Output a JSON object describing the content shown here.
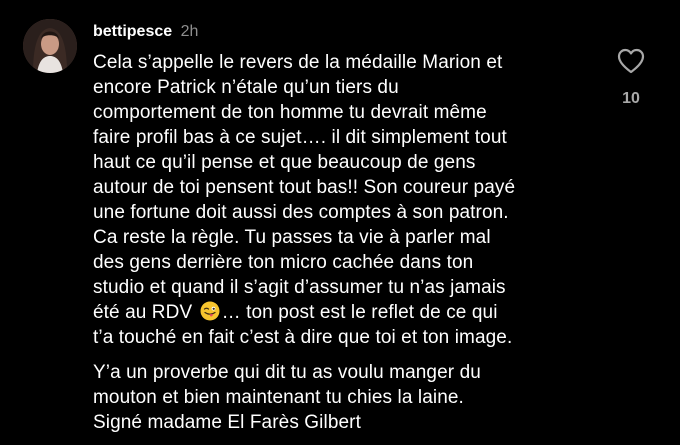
{
  "comment": {
    "username": "bettipesce",
    "timestamp": "2h",
    "paragraphs": [
      [
        "Cela  s’appelle le revers de la médaille Marion et",
        "encore Patrick n’étale qu’un tiers du",
        "comportement de ton homme tu devrait même",
        "faire profil bas à ce sujet…. il dit simplement tout",
        "haut ce qu’il pense et que beaucoup de gens",
        "autour de toi pensent tout bas!! Son coureur payé",
        "une fortune doit aussi des  comptes à son patron.",
        "Ca reste la règle. Tu passes ta vie à parler mal",
        "des gens derrière ton micro cachée dans ton",
        "studio et quand il s’agit d’assumer tu n’as jamais"
      ],
      [
        "Y’a un proverbe qui dit tu as voulu manger du",
        "mouton et bien maintenant tu chies la laine.",
        "Signé madame El Farès Gilbert"
      ]
    ],
    "emoji_line_before": "été au RDV",
    "emoji_name": "winking-face-with-tongue",
    "emoji_line_after": "… ton post est le reflet de ce qui",
    "last_line_para1": "t’a touché en fait c’est à dire que toi et ton image.",
    "like_icon": "heart-outline-icon",
    "like_count": "10"
  },
  "colors": {
    "background": "#000000",
    "text": "#ffffff",
    "secondary": "#8e8e8e",
    "like_count": "#a8a8a8",
    "emoji_face": "#f7c42e",
    "emoji_tongue": "#e8505b"
  }
}
